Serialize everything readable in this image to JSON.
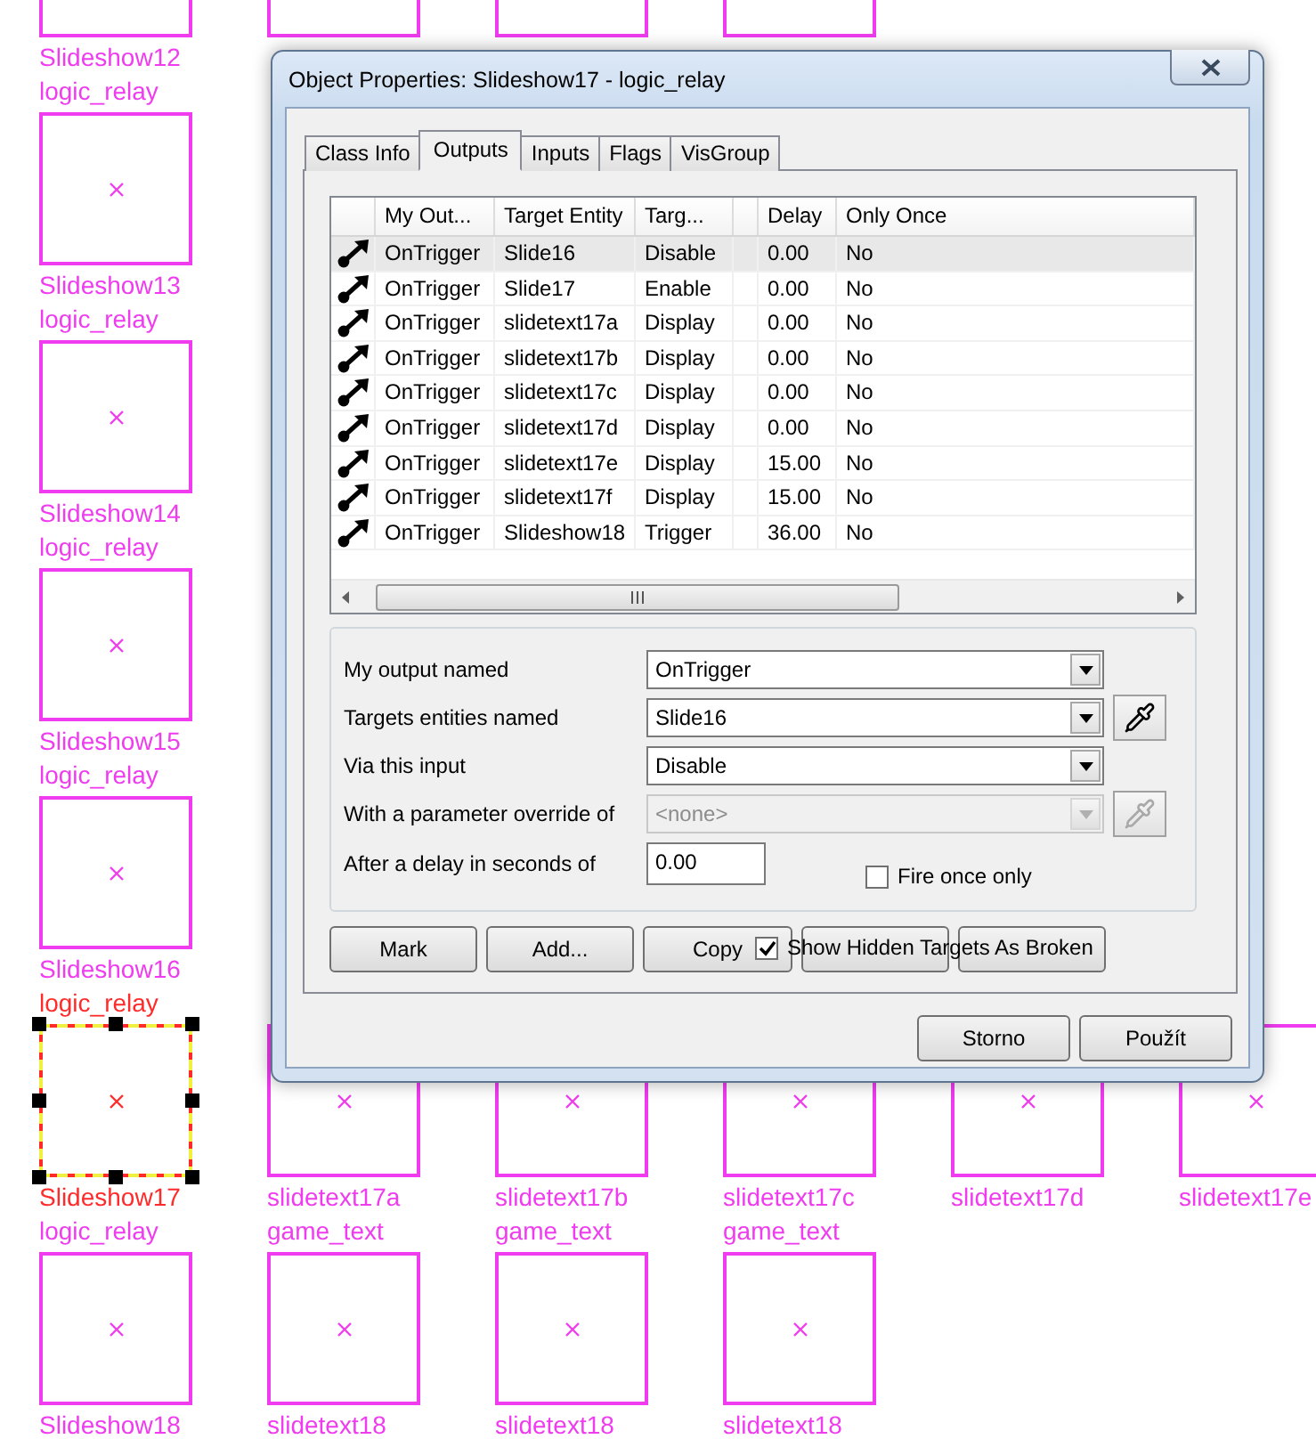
{
  "canvas": {
    "rows": [
      {
        "cells": [
          {
            "kind": "entity_edge",
            "name": "Slideshow12",
            "selected": false
          },
          {
            "kind": "entity_edge",
            "selected": false
          },
          {
            "kind": "entity_edge",
            "selected": false
          },
          {
            "kind": "entity_edge",
            "selected": false
          },
          {
            "kind": "empty"
          },
          {
            "kind": "empty"
          }
        ]
      },
      {
        "cells": [
          {
            "kind": "entity",
            "class_name": "logic_relay",
            "name": "Slideshow13",
            "selected": false
          }
        ]
      },
      {
        "cells": [
          {
            "kind": "entity",
            "class_name": "logic_relay",
            "name": "Slideshow14",
            "selected": false
          }
        ]
      },
      {
        "cells": [
          {
            "kind": "entity",
            "class_name": "logic_relay",
            "name": "Slideshow15",
            "selected": false
          }
        ]
      },
      {
        "cells": [
          {
            "kind": "entity",
            "class_name": "logic_relay",
            "name": "Slideshow16",
            "selected": false
          }
        ]
      },
      {
        "cells": [
          {
            "kind": "entity",
            "class_name": "logic_relay",
            "name": "Slideshow17",
            "selected": true
          },
          {
            "kind": "entity",
            "name": "slidetext17a",
            "selected": false
          },
          {
            "kind": "entity",
            "name": "slidetext17b",
            "selected": false
          },
          {
            "kind": "entity",
            "name": "slidetext17c",
            "selected": false
          },
          {
            "kind": "entity",
            "name": "slidetext17d",
            "selected": false
          },
          {
            "kind": "entity",
            "name": "slidetext17e",
            "selected": false
          }
        ]
      },
      {
        "cells": [
          {
            "kind": "entity",
            "class_name": "logic_relay",
            "name": "Slideshow18",
            "selected": false
          },
          {
            "kind": "entity",
            "class_name": "game_text",
            "name": "slidetext18",
            "selected": false
          },
          {
            "kind": "entity",
            "class_name": "game_text",
            "name": "slidetext18",
            "selected": false
          },
          {
            "kind": "entity",
            "class_name": "game_text",
            "name": "slidetext18",
            "selected": false
          }
        ]
      }
    ]
  },
  "dialog": {
    "title": "Object Properties: Slideshow17 - logic_relay",
    "tabs": [
      {
        "label": "Class Info",
        "selected": false
      },
      {
        "label": "Outputs",
        "selected": true
      },
      {
        "label": "Inputs",
        "selected": false
      },
      {
        "label": "Flags",
        "selected": false
      },
      {
        "label": "VisGroup",
        "selected": false
      }
    ],
    "outputs_table": {
      "columns": [
        "My Out...",
        "Target Entity",
        "Targ...",
        "Delay",
        "Only Once"
      ],
      "rows": [
        {
          "cells": [
            "OnTrigger",
            "Slide16",
            "Disable",
            "0.00",
            "No"
          ],
          "selected": true
        },
        {
          "cells": [
            "OnTrigger",
            "Slide17",
            "Enable",
            "0.00",
            "No"
          ],
          "selected": false
        },
        {
          "cells": [
            "OnTrigger",
            "slidetext17a",
            "Display",
            "0.00",
            "No"
          ],
          "selected": false
        },
        {
          "cells": [
            "OnTrigger",
            "slidetext17b",
            "Display",
            "0.00",
            "No"
          ],
          "selected": false
        },
        {
          "cells": [
            "OnTrigger",
            "slidetext17c",
            "Display",
            "0.00",
            "No"
          ],
          "selected": false
        },
        {
          "cells": [
            "OnTrigger",
            "slidetext17d",
            "Display",
            "0.00",
            "No"
          ],
          "selected": false
        },
        {
          "cells": [
            "OnTrigger",
            "slidetext17e",
            "Display",
            "15.00",
            "No"
          ],
          "selected": false
        },
        {
          "cells": [
            "OnTrigger",
            "slidetext17f",
            "Display",
            "15.00",
            "No"
          ],
          "selected": false
        },
        {
          "cells": [
            "OnTrigger",
            "Slideshow18",
            "Trigger",
            "36.00",
            "No"
          ],
          "selected": false
        }
      ]
    },
    "form": {
      "fields": [
        {
          "label": "My output named",
          "kind": "combo",
          "value": "OnTrigger",
          "disabled": false,
          "picker": false
        },
        {
          "label": "Targets entities named",
          "kind": "combo",
          "value": "Slide16",
          "disabled": false,
          "picker": true
        },
        {
          "label": "Via this input",
          "kind": "combo",
          "value": "Disable",
          "disabled": false,
          "picker": false
        },
        {
          "label": "With a parameter override of",
          "kind": "combo",
          "value": "<none>",
          "disabled": true,
          "picker": true
        },
        {
          "label": "After a delay in seconds of",
          "kind": "text",
          "value": "0.00",
          "disabled": false,
          "picker": false
        }
      ],
      "fire_once": {
        "label": "Fire once only",
        "checked": false
      }
    },
    "buttons": [
      {
        "kind": "button",
        "label": "Mark"
      },
      {
        "kind": "button",
        "label": "Add..."
      },
      {
        "kind": "button",
        "label": "Copy"
      },
      {
        "kind": "covered"
      },
      {
        "kind": "covered"
      }
    ],
    "show_hidden": {
      "label": "Show Hidden Targets As Broken",
      "checked": true
    },
    "footer_buttons": [
      {
        "label": "Storno"
      },
      {
        "label": "Použít"
      }
    ]
  }
}
